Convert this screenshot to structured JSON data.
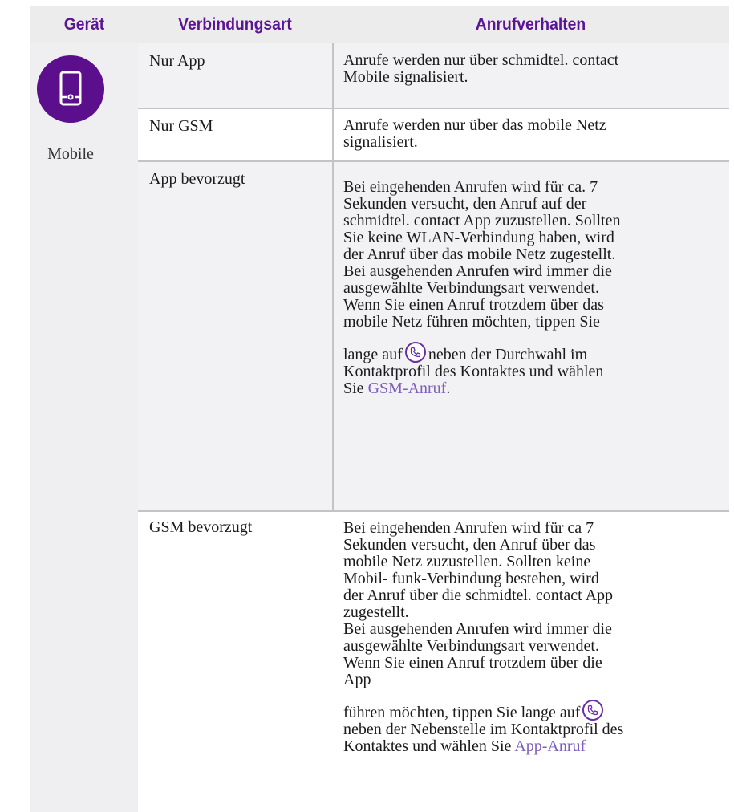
{
  "header": {
    "device": "Gerät",
    "connection_type": "Verbindungsart",
    "call_behavior": "Anrufverhalten"
  },
  "device": {
    "label": "Mobile",
    "icon": "mobile-phone-icon",
    "icon_bg": "#5b0f8c"
  },
  "colors": {
    "accent": "#5b1496",
    "link": "#7e5fbc",
    "header_bg": "#ececec"
  },
  "rows": [
    {
      "type": "Nur App",
      "desc": [
        "Anrufe werden nur über schmidtel. contact",
        "Mobile signalisiert."
      ]
    },
    {
      "type": "Nur GSM",
      "desc": [
        "Anrufe werden nur über das mobile Netz",
        "signalisiert."
      ]
    },
    {
      "type": "App bevorzugt",
      "desc": [
        "Bei eingehenden Anrufen wird für ca. 7",
        "Sekunden versucht, den Anruf auf der",
        "schmidtel. contact App zuzustellen. Sollten",
        "Sie keine WLAN-Verbindung haben, wird",
        "der Anruf über das mobile Netz zugestellt.",
        "Bei ausgehenden Anrufen wird immer die",
        "ausgewählte Verbindungsart verwendet.",
        "Wenn Sie einen Anruf trotzdem über das",
        "mobile Netz führen möchten, tippen Sie"
      ],
      "desc2_pre": "lange auf",
      "desc2_mid": "neben der Durchwahl im",
      "desc2_lines": [
        "Kontaktprofil des Kontaktes und wählen"
      ],
      "desc2_last_pre": "Sie",
      "desc2_link": "GSM-Anruf",
      "desc2_last_post": "."
    },
    {
      "type": "GSM bevorzugt",
      "desc": [
        "Bei eingehenden Anrufen wird für ca 7",
        "Sekunden versucht, den Anruf über das",
        "mobile Netz zuzustellen. Sollten keine",
        "Mobil- funk-Verbindung bestehen, wird",
        "der Anruf über die schmidtel. contact App",
        "zugestellt.",
        "Bei ausgehenden Anrufen wird immer die",
        "ausgewählte Verbindungsart verwendet.",
        "Wenn Sie einen Anruf trotzdem über die",
        "App"
      ],
      "desc2_pre": "führen möchten, tippen Sie lange auf",
      "desc2_lines": [
        "neben der Nebenstelle im Kontaktprofil des"
      ],
      "desc2_last_pre": "Kontaktes und wählen Sie",
      "desc2_link": "App-Anruf",
      "desc2_last_post": ""
    }
  ]
}
